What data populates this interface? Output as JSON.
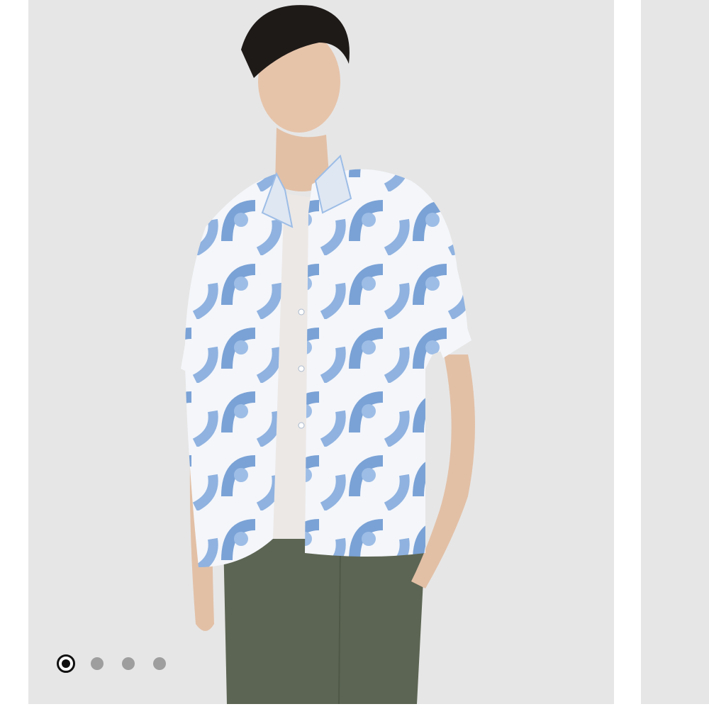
{
  "carousel": {
    "slide_count": 4,
    "active_index": 0,
    "slides": [
      {
        "image": "model-wearing-blue-abstract-print-short-sleeve-camp-shirt"
      },
      {
        "image": "product-image-2"
      },
      {
        "image": "product-image-3"
      },
      {
        "image": "product-image-4"
      }
    ]
  },
  "colors": {
    "background": "#e6e6e6",
    "shirt_blue": "#7aa2d6",
    "pants_olive": "#5c6553",
    "dot_inactive": "#9e9e9e",
    "dot_active": "#111111"
  }
}
